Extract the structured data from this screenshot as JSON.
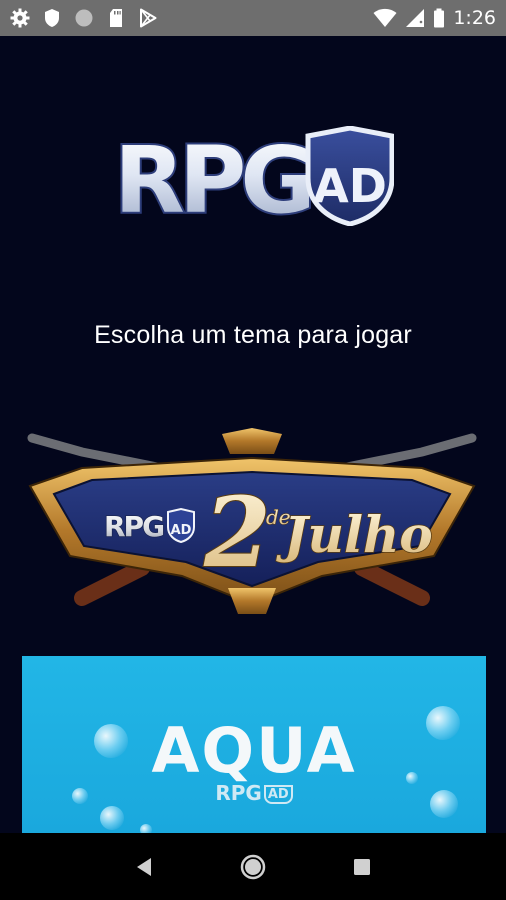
{
  "status_bar": {
    "time": "1:26",
    "left_icons": [
      "gear-icon",
      "shield-icon",
      "circle-icon",
      "sd-card-icon",
      "play-store-icon"
    ],
    "right_icons": [
      "wifi-icon",
      "signal-icon",
      "battery-icon"
    ]
  },
  "logo": {
    "text": "RPG",
    "badge": "AD"
  },
  "subtitle": "Escolha um tema para jogar",
  "themes": [
    {
      "logo_text": "RPG",
      "logo_badge": "AD",
      "title_number": "2",
      "title_small": "de",
      "title_word": "Julho"
    },
    {
      "title": "AQUA",
      "logo_text": "RPG",
      "logo_badge": "AD"
    }
  ],
  "nav_bar": {
    "buttons": [
      "back-icon",
      "home-icon",
      "recents-icon"
    ]
  },
  "colors": {
    "background": "#03061c",
    "status_bar": "#6e6e6e",
    "aqua": "#1fb2e4",
    "nav_bar": "#000000"
  }
}
